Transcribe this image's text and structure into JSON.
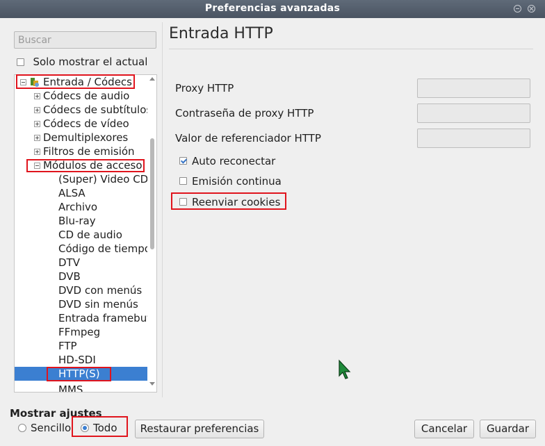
{
  "window": {
    "title": "Preferencias avanzadas"
  },
  "search": {
    "placeholder": "Buscar"
  },
  "only_current_label": "Solo mostrar el actual",
  "tree": {
    "root": "Entrada / Códecs",
    "categories": [
      "Códecs de audio",
      "Códecs de subtítulos",
      "Códecs de vídeo",
      "Demultiplexores",
      "Filtros de emisión",
      "Módulos de acceso"
    ],
    "access_modules": [
      "(Super) Video CD",
      "ALSA",
      "Archivo",
      "Blu-ray",
      "CD de audio",
      "Código de tiempo",
      "DTV",
      "DVB",
      "DVD con menús",
      "DVD sin menús",
      "Entrada framebuffer",
      "FFmpeg",
      "FTP",
      "HD-SDI",
      "HTTP(S)",
      "MMS"
    ],
    "selected": "HTTP(S)"
  },
  "panel": {
    "title": "Entrada HTTP",
    "fields": [
      {
        "label": "Proxy HTTP",
        "value": ""
      },
      {
        "label": "Contraseña de proxy HTTP",
        "value": ""
      },
      {
        "label": "Valor de referenciador HTTP",
        "value": ""
      }
    ],
    "options": [
      {
        "label": "Auto reconectar",
        "checked": true
      },
      {
        "label": "Emisión continua",
        "checked": false
      },
      {
        "label": "Reenviar cookies",
        "checked": false
      }
    ]
  },
  "show_settings": {
    "label": "Mostrar ajustes",
    "simple": "Sencillo",
    "all": "Todo",
    "selected": "Todo"
  },
  "buttons": {
    "reset": "Restaurar preferencias",
    "cancel": "Cancelar",
    "save": "Guardar"
  },
  "colors": {
    "selection": "#3b7fd1",
    "highlight_box": "#e0141d"
  }
}
